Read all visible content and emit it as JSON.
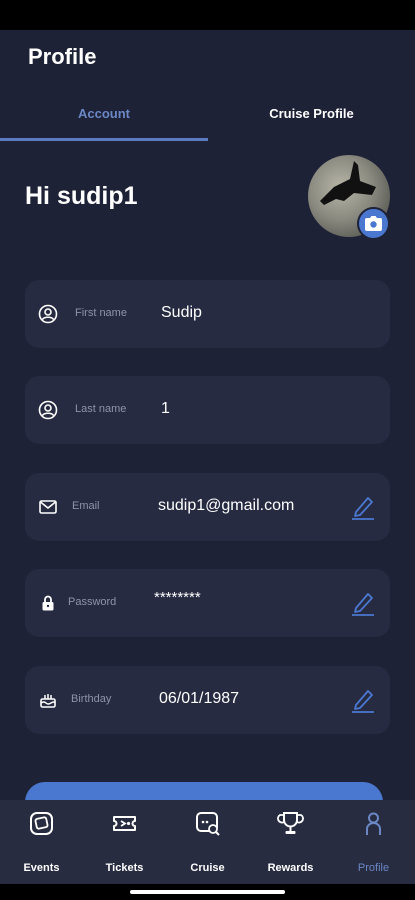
{
  "header": {
    "title": "Profile"
  },
  "tabs": [
    {
      "label": "Account",
      "active": true
    },
    {
      "label": "Cruise Profile",
      "active": false
    }
  ],
  "greeting": "Hi sudip1",
  "fields": {
    "first_name": {
      "label": "First name",
      "value": "Sudip",
      "icon": "user-circle-icon"
    },
    "last_name": {
      "label": "Last name",
      "value": "1",
      "icon": "user-circle-icon"
    },
    "email": {
      "label": "Email",
      "value": "sudip1@gmail.com",
      "icon": "envelope-icon"
    },
    "password": {
      "label": "Password",
      "value": "********",
      "icon": "lock-icon"
    },
    "birthday": {
      "label": "Birthday",
      "value": "06/01/1987",
      "icon": "cake-icon"
    }
  },
  "bottom_nav": [
    {
      "label": "Events",
      "icon": "events-icon",
      "active": false
    },
    {
      "label": "Tickets",
      "icon": "ticket-icon",
      "active": false
    },
    {
      "label": "Cruise",
      "icon": "cruise-search-icon",
      "active": false
    },
    {
      "label": "Rewards",
      "icon": "trophy-icon",
      "active": false
    },
    {
      "label": "Profile",
      "icon": "person-icon",
      "active": true
    }
  ],
  "colors": {
    "background": "#1e2236",
    "field_background": "#262b42",
    "accent": "#4a78d0",
    "active_tab": "#6b87c6"
  }
}
